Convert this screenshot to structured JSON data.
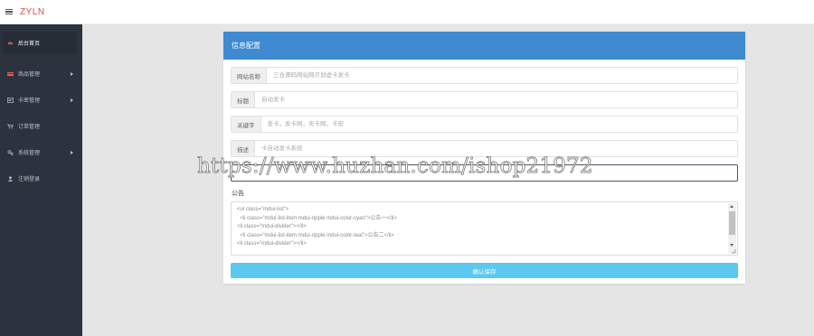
{
  "app": {
    "brand": "ZYLN"
  },
  "sidebar": {
    "items": [
      {
        "label": "后台首页",
        "icon": "dashboard-icon",
        "has_arrow": false
      },
      {
        "label": "商品管理",
        "icon": "goods-icon",
        "has_arrow": true
      },
      {
        "label": "卡密管理",
        "icon": "card-key-icon",
        "has_arrow": true
      },
      {
        "label": "订单管理",
        "icon": "cart-icon",
        "has_arrow": false
      },
      {
        "label": "系统管理",
        "icon": "settings-icon",
        "has_arrow": true
      },
      {
        "label": "注销登录",
        "icon": "user-icon",
        "has_arrow": false
      }
    ]
  },
  "card": {
    "title": "信息配置",
    "fields": {
      "site_name": {
        "label": "网站名称",
        "placeholder": "三合源码网站网贝划虚卡发卡"
      },
      "title": {
        "label": "标题",
        "placeholder": "自动发卡"
      },
      "keywords": {
        "label": "关键字",
        "placeholder": "发卡，发卡网，卖卡网，卡密"
      },
      "description": {
        "label": "描述",
        "placeholder": "卡自动发卡系统"
      }
    },
    "notice_label": "公告",
    "notice_lines": [
      "<ul class=\"mdui-list\">",
      "  <li class=\"mdui-list-item mdui-ripple mdui-color-cyan\">公告一</li>",
      "<li class=\"mdui-divider\"></li>",
      "  <li class=\"mdui-list-item mdui-ripple mdui-color-teal\">公告二</li>",
      "<li class=\"mdui-divider\"></li>"
    ],
    "save_label": "确认保存"
  },
  "watermark": "https://www.huzhan.com/ishop21972",
  "colors": {
    "accent": "#3f8ad1",
    "brand": "#e04848",
    "save_button": "#5bc8ef",
    "sidebar": "#2b333e"
  }
}
